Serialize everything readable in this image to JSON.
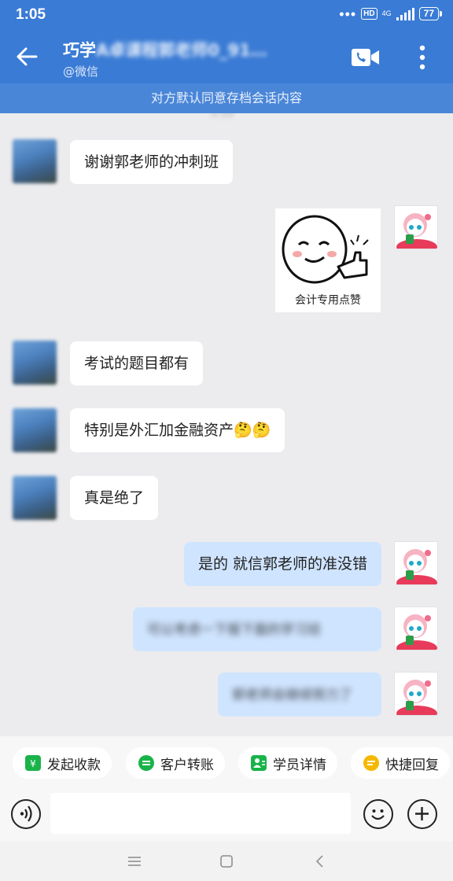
{
  "status": {
    "time": "1:05",
    "more_dots": "•••",
    "hd": "HD",
    "network": "4G",
    "battery": "77"
  },
  "header": {
    "title_visible": "巧学",
    "title_obscured": "A卓课程郭老师0_91…",
    "subtitle": "@微信"
  },
  "notice": "对方默认同意存档会话内容",
  "timestamp_fragment": "0:59",
  "messages": [
    {
      "side": "left",
      "text": "谢谢郭老师的冲刺班"
    },
    {
      "side": "right",
      "type": "sticker",
      "text": "会计专用点赞"
    },
    {
      "side": "left",
      "text": "考试的题目都有"
    },
    {
      "side": "left",
      "text": "特别是外汇加金融资产🤔🤔"
    },
    {
      "side": "left",
      "text": "真是绝了"
    },
    {
      "side": "right",
      "text": "是的  就信郭老师的准没错"
    },
    {
      "side": "right",
      "text": "可以考虑一下报下面的学习班",
      "obscured": true
    },
    {
      "side": "right",
      "text": "郭老师会继续努力了",
      "obscured": true
    }
  ],
  "quick_actions": [
    {
      "label": "发起收款",
      "color": "#19b34a",
      "icon": "yen-icon"
    },
    {
      "label": "客户转账",
      "color": "#19b34a",
      "icon": "transfer-icon"
    },
    {
      "label": "学员详情",
      "color": "#19b34a",
      "icon": "user-card-icon"
    },
    {
      "label": "快捷回复",
      "color": "#f5b800",
      "icon": "quick-reply-icon"
    }
  ],
  "input": {
    "placeholder": ""
  },
  "colors": {
    "accent": "#3a7bd5",
    "self_bubble": "#cfe4ff"
  }
}
